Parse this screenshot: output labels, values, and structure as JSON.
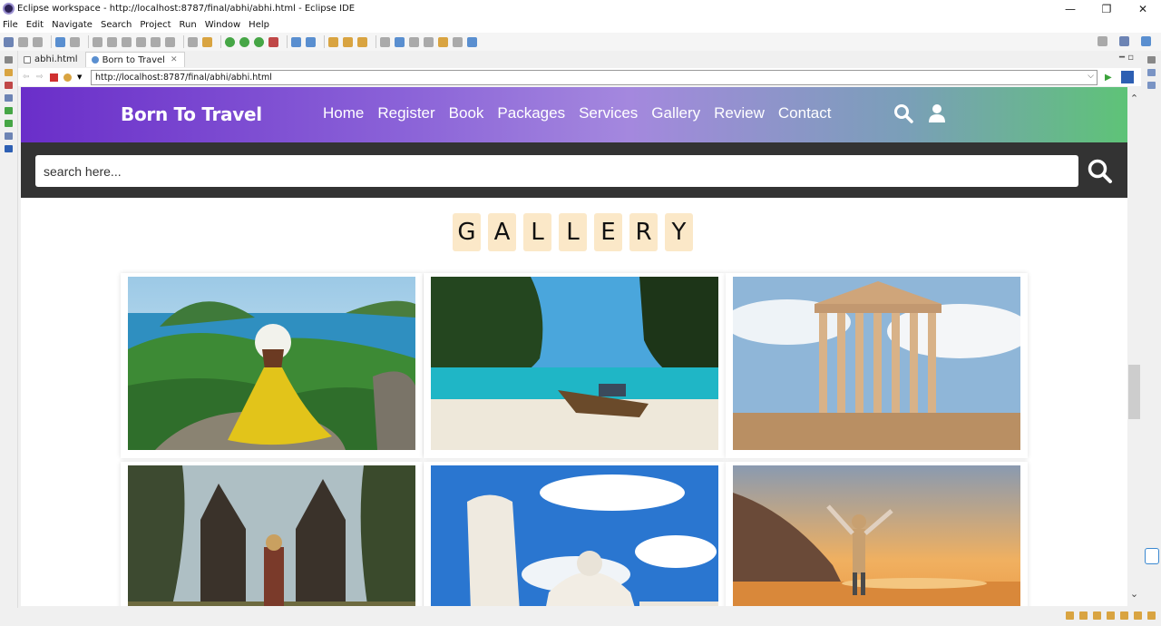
{
  "window": {
    "title": "Eclipse workspace - http://localhost:8787/final/abhi/abhi.html - Eclipse IDE",
    "min_glyph": "—",
    "restore_glyph": "❐",
    "close_glyph": "✕"
  },
  "menu": [
    "File",
    "Edit",
    "Navigate",
    "Search",
    "Project",
    "Run",
    "Window",
    "Help"
  ],
  "editor_tabs": [
    {
      "label": "abhi.html",
      "active": false
    },
    {
      "label": "Born to Travel",
      "active": true,
      "close": "✕"
    }
  ],
  "browser": {
    "url": "http://localhost:8787/final/abhi/abhi.html"
  },
  "site": {
    "logo": "Born To Travel",
    "nav": [
      "Home",
      "Register",
      "Book",
      "Packages",
      "Services",
      "Gallery",
      "Review",
      "Contact"
    ],
    "search_placeholder": "search here...",
    "gallery_letters": [
      "G",
      "A",
      "L",
      "L",
      "E",
      "R",
      "Y"
    ],
    "gallery_images": [
      "woman-in-yellow-dress-island-view",
      "longtail-boat-tropical-beach",
      "parthenon-ruins",
      "bali-temple-gate-traveler",
      "leaning-tower-of-pisa",
      "traveler-on-beach-at-sunset"
    ]
  },
  "colors": {
    "header_gradient_start": "#6a2ec9",
    "header_gradient_end": "#5ec377",
    "search_band": "#333333",
    "letter_tile": "#fbe8c8"
  }
}
